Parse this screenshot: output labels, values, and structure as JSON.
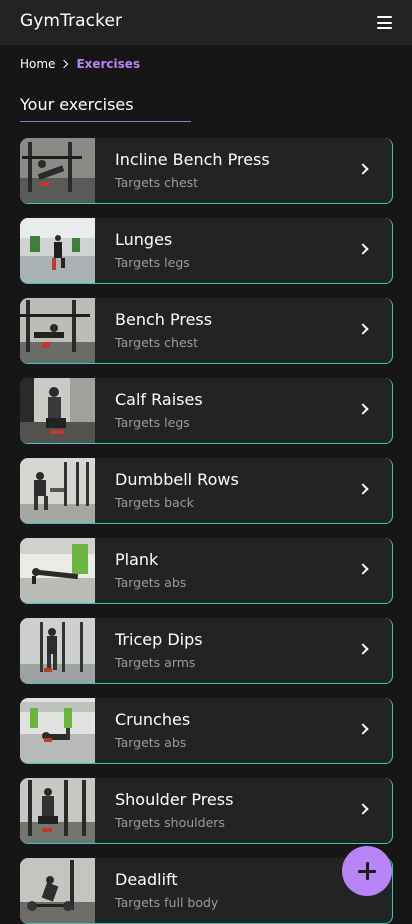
{
  "app": {
    "title": "GymTracker"
  },
  "header": {
    "menu_icon": "hamburger-menu-icon"
  },
  "breadcrumb": {
    "home": "Home",
    "current": "Exercises",
    "separator_icon": "chevron-right-icon"
  },
  "section": {
    "title": "Your exercises"
  },
  "colors": {
    "accent": "#b785f5",
    "card_border": "#3fc5b6",
    "background": "#161616",
    "card": "#232323"
  },
  "exercises": [
    {
      "name": "Incline Bench Press",
      "target": "Targets chest"
    },
    {
      "name": "Lunges",
      "target": "Targets legs"
    },
    {
      "name": "Bench Press",
      "target": "Targets chest"
    },
    {
      "name": "Calf Raises",
      "target": "Targets legs"
    },
    {
      "name": "Dumbbell Rows",
      "target": "Targets back"
    },
    {
      "name": "Plank",
      "target": "Targets abs"
    },
    {
      "name": "Tricep Dips",
      "target": "Targets arms"
    },
    {
      "name": "Crunches",
      "target": "Targets abs"
    },
    {
      "name": "Shoulder Press",
      "target": "Targets shoulders"
    },
    {
      "name": "Deadlift",
      "target": "Targets full body"
    }
  ],
  "fab": {
    "icon": "plus-icon"
  }
}
